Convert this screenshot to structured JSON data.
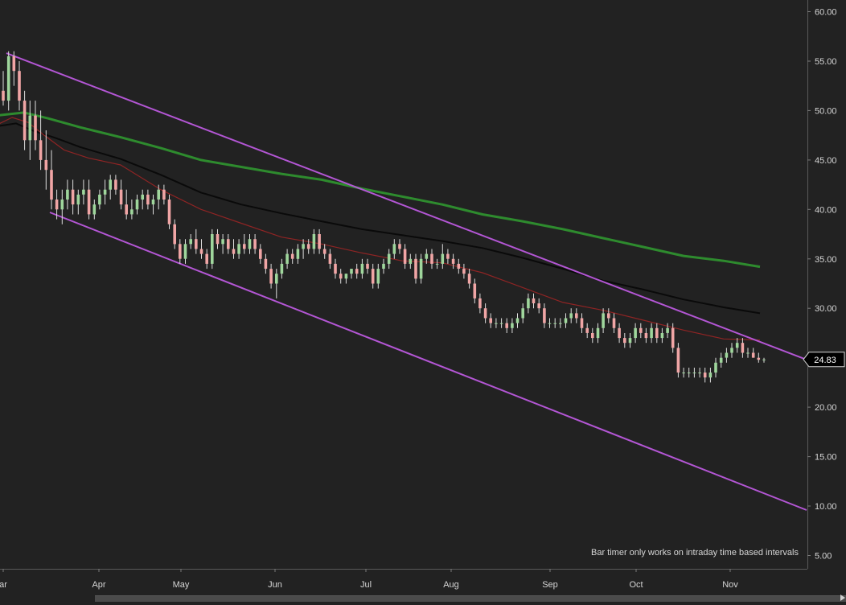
{
  "chart_data": {
    "type": "candlestick",
    "title": "",
    "ylim": [
      3.5,
      61.5
    ],
    "y_ticks": [
      "60.00",
      "55.00",
      "50.00",
      "45.00",
      "40.00",
      "35.00",
      "30.00",
      "25.00",
      "20.00",
      "15.00",
      "10.00",
      "5.00"
    ],
    "x_ticks": [
      "ar",
      "Apr",
      "May",
      "Jun",
      "Jul",
      "Aug",
      "Sep",
      "Oct",
      "Nov"
    ],
    "last_price_label": "24.83",
    "last_price": 24.83,
    "colors": {
      "background": "#222222",
      "axis_text": "#d6d6d6",
      "up_candle": "#9fd69c",
      "down_candle": "#f0a5a5",
      "wick": "#dedede",
      "channel": "#b356d4",
      "ma_green": "#2e8b2e",
      "ma_black": "#0a0a0a",
      "ma_red": "#8e2424"
    },
    "candles": [
      [
        52,
        54,
        50.5,
        51
      ],
      [
        51,
        56,
        50,
        55.5
      ],
      [
        55.5,
        56,
        52.5,
        54
      ],
      [
        54,
        55,
        50,
        51
      ],
      [
        51,
        52,
        46,
        47
      ],
      [
        47,
        51,
        45,
        49.5
      ],
      [
        49.5,
        51,
        46,
        47
      ],
      [
        47,
        50,
        44,
        45
      ],
      [
        45,
        48,
        42,
        44
      ],
      [
        44,
        46,
        40,
        41
      ],
      [
        41,
        42,
        39,
        40
      ],
      [
        40,
        42,
        38.5,
        41
      ],
      [
        41,
        43,
        40,
        42
      ],
      [
        42,
        43,
        39.5,
        40.5
      ],
      [
        40.5,
        42,
        39.5,
        41.5
      ],
      [
        41.5,
        43,
        40.5,
        42
      ],
      [
        42,
        43,
        39,
        39.5
      ],
      [
        39.5,
        41,
        39,
        40.5
      ],
      [
        40.5,
        42,
        40,
        41.5
      ],
      [
        41.5,
        43,
        40.5,
        42
      ],
      [
        42,
        43.5,
        41,
        43
      ],
      [
        43,
        43.5,
        41.5,
        42
      ],
      [
        42,
        43,
        40,
        40.5
      ],
      [
        40.5,
        42,
        39,
        39.5
      ],
      [
        39.5,
        41,
        39,
        40
      ],
      [
        40,
        41.5,
        39.5,
        41
      ],
      [
        41,
        42,
        40,
        41.5
      ],
      [
        41.5,
        42,
        40,
        40.5
      ],
      [
        40.5,
        41.5,
        39.5,
        41
      ],
      [
        41,
        42.5,
        40,
        42
      ],
      [
        42,
        42.5,
        40.5,
        41
      ],
      [
        41,
        41.5,
        38,
        38.5
      ],
      [
        38.5,
        39,
        36,
        36.5
      ],
      [
        36.5,
        37,
        34.5,
        35
      ],
      [
        35,
        37,
        34.5,
        36.5
      ],
      [
        36.5,
        37.5,
        36,
        37
      ],
      [
        37,
        38,
        35.5,
        36
      ],
      [
        36,
        37,
        35,
        35.5
      ],
      [
        35.5,
        36,
        34,
        34.5
      ],
      [
        34.5,
        38,
        34,
        37.5
      ],
      [
        37.5,
        38,
        36,
        36.5
      ],
      [
        36.5,
        37.5,
        35.5,
        37
      ],
      [
        37,
        37.5,
        35.5,
        36
      ],
      [
        36,
        37,
        35,
        35.5
      ],
      [
        35.5,
        37,
        35,
        36.5
      ],
      [
        36.5,
        37.5,
        35.5,
        36
      ],
      [
        36,
        37.5,
        35.5,
        37
      ],
      [
        37,
        37.5,
        35.5,
        36
      ],
      [
        36,
        36.5,
        34.5,
        35
      ],
      [
        35,
        35.5,
        33.5,
        34
      ],
      [
        34,
        34.5,
        32,
        32.5
      ],
      [
        32.5,
        34,
        31,
        33.5
      ],
      [
        33.5,
        35,
        33,
        34.5
      ],
      [
        34.5,
        36,
        34,
        35.5
      ],
      [
        35.5,
        36,
        34.5,
        35
      ],
      [
        35,
        36.5,
        34.5,
        36
      ],
      [
        36,
        37,
        35,
        36.5
      ],
      [
        36.5,
        37,
        35.5,
        36
      ],
      [
        36,
        38,
        35.5,
        37.5
      ],
      [
        37.5,
        38,
        35.5,
        36
      ],
      [
        36,
        36.5,
        35,
        35.5
      ],
      [
        35.5,
        36,
        34,
        34.5
      ],
      [
        34.5,
        35,
        33,
        33.5
      ],
      [
        33.5,
        34,
        32.5,
        33
      ],
      [
        33,
        33.5,
        32.5,
        33.5
      ],
      [
        33.5,
        34,
        33,
        34
      ],
      [
        34,
        34.5,
        33,
        33.5
      ],
      [
        33.5,
        35,
        33,
        34.5
      ],
      [
        34.5,
        35,
        33.5,
        34
      ],
      [
        34,
        34.5,
        32,
        32.5
      ],
      [
        32.5,
        34.5,
        32,
        34
      ],
      [
        34,
        35,
        33.5,
        34.5
      ],
      [
        34.5,
        36,
        34,
        35.5
      ],
      [
        35.5,
        37,
        35,
        36.5
      ],
      [
        36.5,
        37,
        35.5,
        36
      ],
      [
        36,
        36.5,
        34,
        34.5
      ],
      [
        34.5,
        35.5,
        34,
        35
      ],
      [
        35,
        35.5,
        32.5,
        33
      ],
      [
        33,
        35.5,
        32.5,
        35
      ],
      [
        35,
        36,
        34.5,
        35.5
      ],
      [
        35.5,
        36,
        34,
        34.5
      ],
      [
        34.5,
        35,
        34,
        34.5
      ],
      [
        34.5,
        36.5,
        34,
        35.5
      ],
      [
        35.5,
        36,
        34.5,
        35
      ],
      [
        35,
        35.5,
        34,
        34.5
      ],
      [
        34.5,
        35,
        33.5,
        34
      ],
      [
        34,
        34.5,
        33,
        33.5
      ],
      [
        33.5,
        34,
        32,
        32.5
      ],
      [
        32.5,
        33,
        30.5,
        31
      ],
      [
        31,
        31.5,
        29.5,
        30
      ],
      [
        30,
        30.5,
        28.5,
        29
      ],
      [
        29,
        29.5,
        28,
        28.5
      ],
      [
        28.5,
        29,
        28,
        28.5
      ],
      [
        28.5,
        29,
        28,
        28.5
      ],
      [
        28.5,
        29,
        27.5,
        28
      ],
      [
        28,
        29,
        27.5,
        28.5
      ],
      [
        28.5,
        29.5,
        28,
        29
      ],
      [
        29,
        30.5,
        28.5,
        30
      ],
      [
        30,
        31.5,
        29.5,
        31
      ],
      [
        31,
        31.5,
        30,
        30.5
      ],
      [
        30.5,
        31,
        29.5,
        30
      ],
      [
        30,
        30.5,
        28,
        28.5
      ],
      [
        28.5,
        29,
        28,
        28.5
      ],
      [
        28.5,
        29,
        28,
        28.5
      ],
      [
        28.5,
        29,
        28,
        28.5
      ],
      [
        28.5,
        29.5,
        28,
        29
      ],
      [
        29,
        30,
        28.5,
        29.5
      ],
      [
        29.5,
        30,
        28.5,
        29
      ],
      [
        29,
        29.5,
        27.5,
        28
      ],
      [
        28,
        28.5,
        27,
        27.5
      ],
      [
        27.5,
        28,
        26.5,
        27
      ],
      [
        27,
        28.5,
        26.5,
        28
      ],
      [
        28,
        30,
        27.5,
        29.5
      ],
      [
        29.5,
        30,
        28.5,
        29
      ],
      [
        29,
        29.5,
        27.5,
        28
      ],
      [
        28,
        28.5,
        26.5,
        27
      ],
      [
        27,
        27.5,
        26,
        26.5
      ],
      [
        26.5,
        27.5,
        26,
        27
      ],
      [
        27,
        28.5,
        26.5,
        28
      ],
      [
        28,
        28.5,
        27,
        27.5
      ],
      [
        27.5,
        28,
        26.5,
        27
      ],
      [
        27,
        28.5,
        26.5,
        28
      ],
      [
        28,
        28.5,
        26.5,
        27
      ],
      [
        27,
        28,
        26.5,
        27.5
      ],
      [
        27.5,
        28.5,
        27,
        28
      ],
      [
        28,
        28.5,
        25.5,
        26
      ],
      [
        26,
        26.5,
        23,
        23.5
      ],
      [
        23.5,
        24,
        23,
        23.5
      ],
      [
        23.5,
        24,
        23,
        23.5
      ],
      [
        23.5,
        24,
        23,
        23.5
      ],
      [
        23.5,
        24,
        23,
        23.5
      ],
      [
        23.5,
        24,
        22.5,
        23
      ],
      [
        23,
        24,
        22.5,
        23.5
      ],
      [
        23.5,
        25,
        23,
        24.5
      ],
      [
        24.5,
        25.5,
        24,
        25
      ],
      [
        25,
        26,
        24.5,
        25.5
      ],
      [
        25.5,
        26.5,
        25,
        26
      ],
      [
        26,
        27,
        25.5,
        26.5
      ],
      [
        26.5,
        27,
        25,
        25.5
      ],
      [
        25.5,
        26,
        25,
        25.5
      ],
      [
        25.5,
        26,
        25,
        25
      ],
      [
        25,
        25.5,
        24.5,
        24.8
      ],
      [
        24.8,
        25,
        24.5,
        24.83
      ]
    ],
    "moving_averages": [
      {
        "key": "ma_green",
        "width": 3,
        "points": [
          [
            -5,
            49.5
          ],
          [
            30,
            49.8
          ],
          [
            60,
            49.2
          ],
          [
            100,
            48.3
          ],
          [
            150,
            47.3
          ],
          [
            200,
            46.2
          ],
          [
            250,
            45.0
          ],
          [
            300,
            44.3
          ],
          [
            350,
            43.6
          ],
          [
            400,
            43.0
          ],
          [
            450,
            42.1
          ],
          [
            500,
            41.3
          ],
          [
            550,
            40.5
          ],
          [
            600,
            39.5
          ],
          [
            650,
            38.8
          ],
          [
            700,
            38.0
          ],
          [
            750,
            37.1
          ],
          [
            800,
            36.2
          ],
          [
            850,
            35.3
          ],
          [
            900,
            34.8
          ],
          [
            945,
            34.2
          ]
        ]
      },
      {
        "key": "ma_black",
        "width": 2,
        "points": [
          [
            -5,
            48.4
          ],
          [
            20,
            48.7
          ],
          [
            40,
            48.0
          ],
          [
            70,
            47.2
          ],
          [
            100,
            46.3
          ],
          [
            150,
            45.1
          ],
          [
            200,
            43.5
          ],
          [
            250,
            41.7
          ],
          [
            300,
            40.5
          ],
          [
            350,
            39.6
          ],
          [
            400,
            38.8
          ],
          [
            450,
            38.0
          ],
          [
            500,
            37.4
          ],
          [
            550,
            36.8
          ],
          [
            600,
            36.1
          ],
          [
            650,
            35.1
          ],
          [
            700,
            34.0
          ],
          [
            750,
            32.8
          ],
          [
            800,
            31.9
          ],
          [
            850,
            30.9
          ],
          [
            900,
            30.1
          ],
          [
            945,
            29.5
          ]
        ]
      },
      {
        "key": "ma_red",
        "width": 1.2,
        "points": [
          [
            -5,
            48.5
          ],
          [
            15,
            49.3
          ],
          [
            35,
            48.8
          ],
          [
            55,
            47.5
          ],
          [
            80,
            46.0
          ],
          [
            110,
            45.2
          ],
          [
            150,
            44.5
          ],
          [
            200,
            42.0
          ],
          [
            250,
            40.0
          ],
          [
            300,
            38.6
          ],
          [
            350,
            37.2
          ],
          [
            400,
            36.5
          ],
          [
            450,
            35.6
          ],
          [
            500,
            34.8
          ],
          [
            550,
            34.6
          ],
          [
            600,
            33.6
          ],
          [
            650,
            32.1
          ],
          [
            700,
            30.6
          ],
          [
            750,
            29.8
          ],
          [
            800,
            28.8
          ],
          [
            850,
            27.8
          ],
          [
            900,
            26.9
          ],
          [
            945,
            26.8
          ]
        ]
      }
    ],
    "channel_lines": [
      {
        "key": "channel",
        "from": [
          8,
          55.8
        ],
        "to": [
          1003,
          24.8
        ]
      },
      {
        "key": "channel",
        "from": [
          62,
          39.7
        ],
        "to": [
          1003,
          9.6
        ]
      }
    ],
    "note": "Bar timer only works on intraday time based intervals"
  }
}
